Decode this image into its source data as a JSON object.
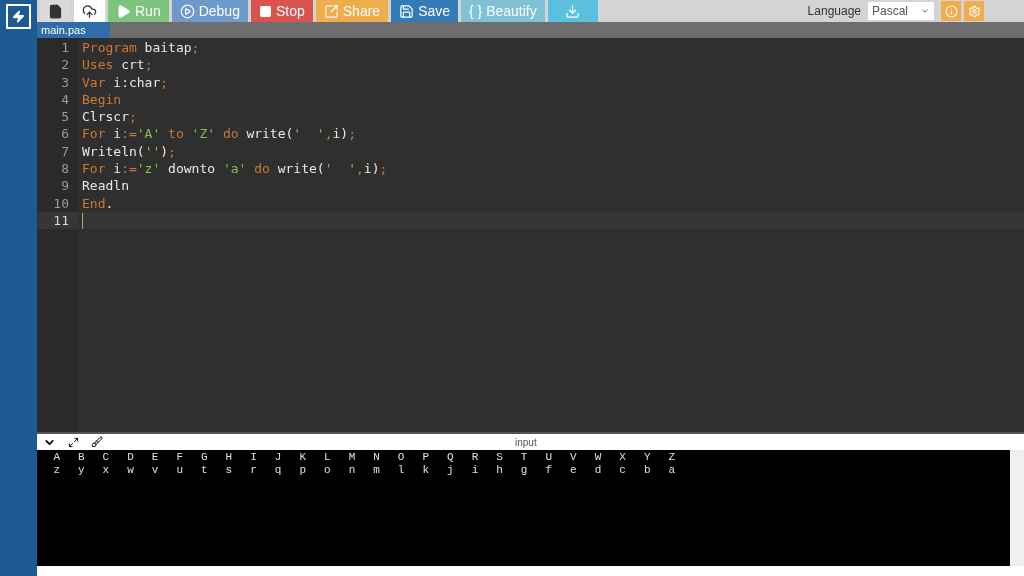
{
  "toolbar": {
    "buttons": [
      {
        "kind": "file",
        "color": "#d9d9d9"
      },
      {
        "kind": "upload",
        "color": "#ffffff"
      },
      {
        "kind": "run",
        "label": "Run",
        "color": "#7cc37c"
      },
      {
        "kind": "debug",
        "label": "Debug",
        "color": "#6d99cc"
      },
      {
        "kind": "stop",
        "label": "Stop",
        "color": "#d9534f"
      },
      {
        "kind": "share",
        "label": "Share",
        "color": "#f0ad4e"
      },
      {
        "kind": "save",
        "label": "Save",
        "color": "#337ab7"
      },
      {
        "kind": "beautify",
        "label": "{ } Beautify",
        "color": "#80c1d6"
      },
      {
        "kind": "download",
        "color": "#5bc0de"
      }
    ],
    "language_label": "Language",
    "language": "Pascal"
  },
  "file_tab": {
    "label": "main.pas",
    "selected": true
  },
  "editor": {
    "lines": [
      {
        "number": "1",
        "active": false,
        "tokens": [
          {
            "t": "Program",
            "kind": "kw"
          },
          {
            "t": " baitap",
            "kind": "plain"
          },
          {
            "t": ";",
            "kind": "kw"
          }
        ]
      },
      {
        "number": "2",
        "active": false,
        "tokens": [
          {
            "t": "Uses",
            "kind": "kw"
          },
          {
            "t": " crt",
            "kind": "plain"
          },
          {
            "t": ";",
            "kind": "kw"
          }
        ]
      },
      {
        "number": "3",
        "active": false,
        "tokens": [
          {
            "t": "Var",
            "kind": "kw"
          },
          {
            "t": " i:char",
            "kind": "plain"
          },
          {
            "t": ";",
            "kind": "kw"
          }
        ]
      },
      {
        "number": "4",
        "active": false,
        "tokens": [
          {
            "t": "Begin",
            "kind": "kw"
          }
        ]
      },
      {
        "number": "5",
        "active": false,
        "tokens": [
          {
            "t": "Clrscr",
            "kind": "plain"
          },
          {
            "t": ";",
            "kind": "kw"
          }
        ]
      },
      {
        "number": "6",
        "active": false,
        "tokens": [
          {
            "t": "For",
            "kind": "kw"
          },
          {
            "t": " i",
            "kind": "plain"
          },
          {
            "t": ":=",
            "kind": "kw"
          },
          {
            "t": "'A'",
            "kind": "str"
          },
          {
            "t": " to ",
            "kind": "kw"
          },
          {
            "t": "'Z'",
            "kind": "str"
          },
          {
            "t": " do ",
            "kind": "kw"
          },
          {
            "t": "write(",
            "kind": "plain"
          },
          {
            "t": "'  '",
            "kind": "str"
          },
          {
            "t": ",",
            "kind": "kw"
          },
          {
            "t": "i)",
            "kind": "plain"
          },
          {
            "t": ";",
            "kind": "kw"
          }
        ]
      },
      {
        "number": "7",
        "active": false,
        "tokens": [
          {
            "t": "Writeln(",
            "kind": "plain"
          },
          {
            "t": "''",
            "kind": "str"
          },
          {
            "t": ")",
            "kind": "plain"
          },
          {
            "t": ";",
            "kind": "kw"
          }
        ]
      },
      {
        "number": "8",
        "active": false,
        "tokens": [
          {
            "t": "For",
            "kind": "kw"
          },
          {
            "t": " i",
            "kind": "plain"
          },
          {
            "t": ":=",
            "kind": "kw"
          },
          {
            "t": "'z'",
            "kind": "str"
          },
          {
            "t": " downto ",
            "kind": "plain"
          },
          {
            "t": "'a'",
            "kind": "str"
          },
          {
            "t": " do ",
            "kind": "kw"
          },
          {
            "t": "write(",
            "kind": "plain"
          },
          {
            "t": "'  '",
            "kind": "str"
          },
          {
            "t": ",",
            "kind": "kw"
          },
          {
            "t": "i)",
            "kind": "plain"
          },
          {
            "t": ";",
            "kind": "kw"
          }
        ]
      },
      {
        "number": "9",
        "active": false,
        "tokens": [
          {
            "t": "Readln",
            "kind": "plain"
          }
        ]
      },
      {
        "number": "10",
        "active": false,
        "tokens": [
          {
            "t": "End",
            "kind": "kw"
          },
          {
            "t": ".",
            "kind": "plain"
          }
        ]
      },
      {
        "number": "11",
        "active": true
      }
    ]
  },
  "output_panel": {
    "title": "input",
    "lines": [
      "  A  B  C  D  E  F  G  H  I  J  K  L  M  N  O  P  Q  R  S  T  U  V  W  X  Y  Z",
      "  z  y  x  w  v  u  t  s  r  q  p  o  n  m  l  k  j  i  h  g  f  e  d  c  b  a"
    ]
  }
}
